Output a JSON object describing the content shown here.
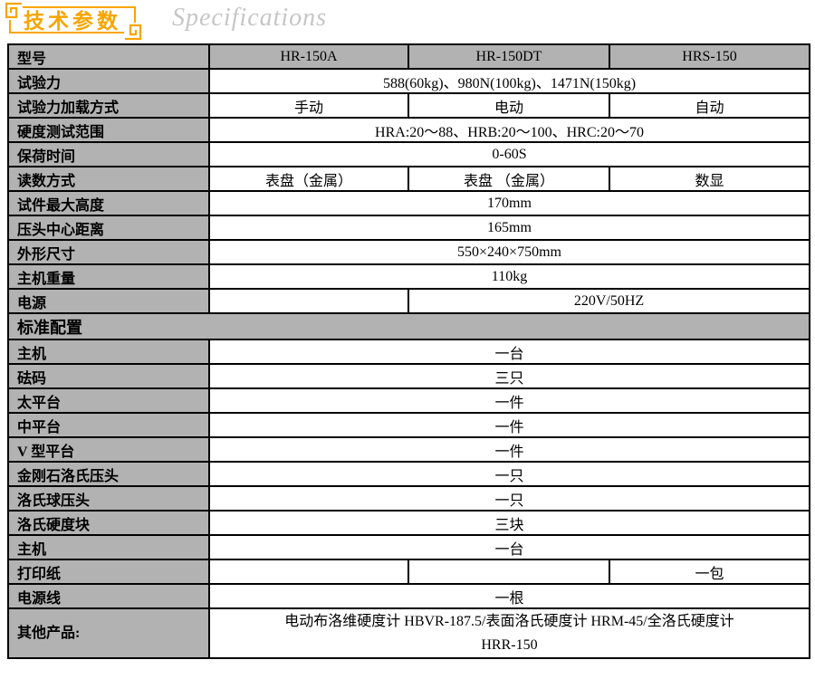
{
  "header": {
    "title": "技术参数",
    "subtitle": "Specifications"
  },
  "colors": {
    "accent_orange": "#F7A501",
    "cell_gray": "#B2B2B2",
    "subtitle_gray": "#C6C6C6",
    "border_black": "#000000"
  },
  "table": {
    "rows": [
      {
        "label": "型号",
        "a": "HR-150A",
        "b": "HR-150DT",
        "c": "HRS-150"
      },
      {
        "label": "试验力",
        "value": "588(60kg)、980N(100kg)、1471N(150kg)"
      },
      {
        "label": "试验力加载方式",
        "a": "手动",
        "b": "电动",
        "c": "自动"
      },
      {
        "label": "硬度测试范围",
        "value": "HRA:20～88、HRB:20～100、HRC:20～70"
      },
      {
        "label": "保荷时间",
        "value": "0-60S"
      },
      {
        "label": "读数方式",
        "a": "表盘（金属）",
        "b": "表盘 （金属）",
        "c": "数显"
      },
      {
        "label": "试件最大高度",
        "value": "170mm"
      },
      {
        "label": "压头中心距离",
        "value": "165mm"
      },
      {
        "label": "外形尺寸",
        "value": "550×240×750mm"
      },
      {
        "label": "主机重量",
        "value": "110kg"
      },
      {
        "label": "电源",
        "a": "",
        "bc": "220V/50HZ"
      },
      {
        "section": "标准配置"
      },
      {
        "label": "主机",
        "value": "一台"
      },
      {
        "label": "砝码",
        "value": "三只"
      },
      {
        "label": "太平台",
        "value": "一件"
      },
      {
        "label": "中平台",
        "value": "一件"
      },
      {
        "label": "V 型平台",
        "value": "一件"
      },
      {
        "label": "金刚石洛氏压头",
        "value": "一只"
      },
      {
        "label": "洛氏球压头",
        "value": "一只"
      },
      {
        "label": "洛氏硬度块",
        "value": "三块"
      },
      {
        "label": "主机",
        "value": "一台"
      },
      {
        "label": "打印纸",
        "a": "",
        "b": "",
        "c": "一包"
      },
      {
        "label": "电源线",
        "value": "一根"
      },
      {
        "label": "其他产品:",
        "value": "电动布洛维硬度计 HBVR-187.5/表面洛氏硬度计 HRM-45/全洛氏硬度计\nHRR-150"
      }
    ]
  }
}
